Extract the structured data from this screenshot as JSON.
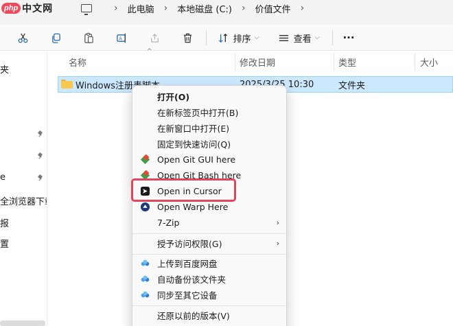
{
  "watermark": {
    "brand": "php",
    "text": "中文网"
  },
  "breadcrumb": [
    "此电脑",
    "本地磁盘 (C:)",
    "价值文件"
  ],
  "toolbar": {
    "sort_label": "排序",
    "view_label": "查看",
    "more_label": "···",
    "icons": [
      "cut-icon",
      "copy-icon",
      "paste-icon",
      "rename-icon",
      "share-icon",
      "delete-icon"
    ]
  },
  "nav": {
    "items": [
      "夹",
      "e",
      "全浏览器下载",
      "报",
      "置"
    ]
  },
  "columns": {
    "name": "名称",
    "modified": "修改日期",
    "type": "类型",
    "size": "大小"
  },
  "file": {
    "name": "Windows注册表脚本",
    "modified": "2025/3/25 10:30",
    "type": "文件夹"
  },
  "context_menu": {
    "items": [
      {
        "label": "打开(O)",
        "icon": "none"
      },
      {
        "label": "在新标签页中打开(B)",
        "icon": "none"
      },
      {
        "label": "在新窗口中打开(E)",
        "icon": "none"
      },
      {
        "label": "固定到快速访问(Q)",
        "icon": "none"
      },
      {
        "label": "Open Git GUI here",
        "icon": "git-icon"
      },
      {
        "label": "Open Git Bash here",
        "icon": "git-icon"
      },
      {
        "label": "Open in Cursor",
        "icon": "cursor-icon"
      },
      {
        "label": "Open Warp Here",
        "icon": "warp-icon"
      },
      {
        "label": "7-Zip",
        "icon": "none"
      },
      {
        "label": "授予访问权限(G)",
        "icon": "none"
      },
      {
        "label": "上传到百度网盘",
        "icon": "baidu-cloud-icon"
      },
      {
        "label": "自动备份该文件夹",
        "icon": "baidu-cloud-icon"
      },
      {
        "label": "同步至其它设备",
        "icon": "baidu-cloud-icon"
      },
      {
        "label": "还原以前的版本(V)",
        "icon": "none"
      }
    ],
    "highlight_color": "#e2445c"
  },
  "colors": {
    "selection": "#cce8ff",
    "folder": "#f8c951",
    "accent": "#e2445c"
  }
}
